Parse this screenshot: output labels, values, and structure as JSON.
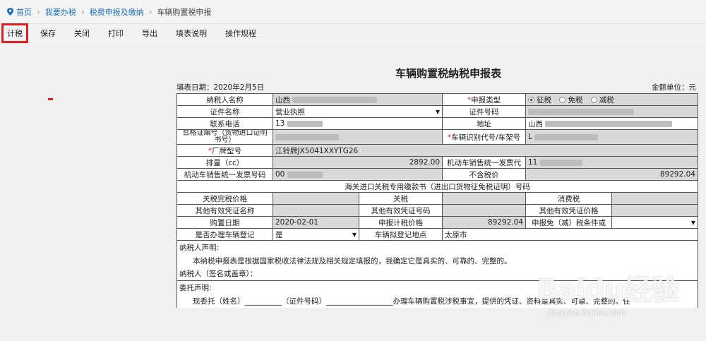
{
  "breadcrumb": {
    "items": [
      "首页",
      "我要办税",
      "税费申报及缴纳",
      "车辆购置税申报"
    ]
  },
  "toolbar": {
    "buttons": [
      "计税",
      "保存",
      "关闭",
      "打印",
      "导出",
      "填表说明",
      "操作规程"
    ]
  },
  "form": {
    "title": "车辆购置税纳税申报表",
    "fill_date": "填表日期：2020年2月5日",
    "unit": "金额单位：元",
    "rows": {
      "taxpayer_name": "纳税人名称",
      "taxpayer_name_val": "山西",
      "declare_type": "申报类型",
      "declare_opts": [
        "征税",
        "免税",
        "减税"
      ],
      "cert_name": "证件名称",
      "cert_name_val": "营业执照",
      "cert_no": "证件号码",
      "phone": "联系电话",
      "phone_val": "13",
      "address": "地址",
      "address_val": "山西",
      "qualify_no": "合格证编号（货物进口证明书号）",
      "vin": "车辆识别代号/车架号",
      "vin_val": "L",
      "brand_model": "厂牌型号",
      "brand_model_val": "江铃牌JX5041XXYTG26",
      "displacement": "排量（cc）",
      "displacement_val": "2892.00",
      "invoice_code": "机动车销售统一发票代",
      "invoice_code_val": "11",
      "invoice_no": "机动车销售统一发票号码",
      "invoice_no_val": "00",
      "pretax_price": "不含税价",
      "pretax_price_val": "89292.04",
      "customs_header": "海关进口关税专用缴款书（进出口货物征免税证明）号码",
      "customs_price": "关税完税价格",
      "tariff": "关税",
      "consumption_tax": "消费税",
      "other_cert_name": "其他有效凭证名称",
      "other_cert_no": "其他有效凭证号码",
      "other_cert_price": "其他有效凭证价格",
      "purchase_date": "购置日期",
      "purchase_date_val": "2020-02-01",
      "declare_price": "申报计税价格",
      "declare_price_val": "89292.04",
      "exempt_cond": "申报免（减）税条件或",
      "register": "是否办理车辆登记",
      "register_val": "是",
      "register_place": "车辆拟登记地点",
      "register_place_val": "太原市"
    },
    "declaration": {
      "taxpayer_title": "纳税人声明:",
      "taxpayer_text": "本纳税申报表是根据国家税收法律法规及相关规定填报的，我确定它是真实的、可靠的、完整的。",
      "signature": "纳税人（签名或盖章）：",
      "entrust_title": "委托声明:",
      "entrust_text": "现委托（姓名）__________（证件号码）__________________办理车辆购置税涉税事宜，提供的凭证、资料是真实、可靠、完整的。任"
    }
  },
  "watermark": {
    "logo": "Baidu经验",
    "url": "jingyan.baidu.com"
  },
  "colors": {
    "link": "#1f6fb8",
    "highlight": "#e02020",
    "readonly_cell": "#d9d9d9"
  }
}
